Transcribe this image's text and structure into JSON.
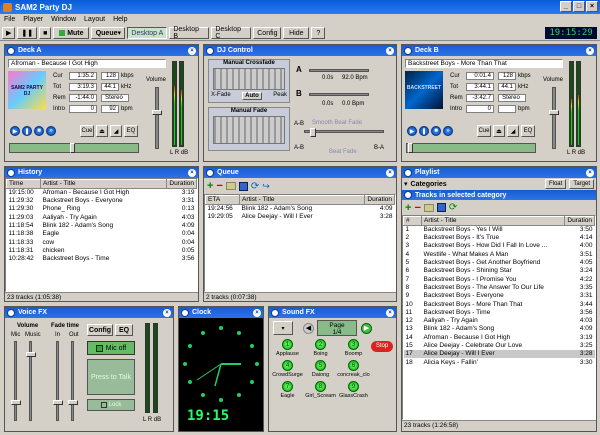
{
  "window": {
    "title": "SAM2 Party DJ"
  },
  "menu": [
    "File",
    "Player",
    "Window",
    "Layout",
    "Help"
  ],
  "toolbar": {
    "mute": "Mute",
    "queue": "Queue",
    "tabs": [
      "Desktop A",
      "Desktop B",
      "Desktop C"
    ],
    "config": "Config",
    "hide": "Hide",
    "help": "?",
    "clock": "19:15:29"
  },
  "deckA": {
    "title": "Deck A",
    "track": "Afroman - Because I Got High",
    "cur": "1:35.2",
    "tot": "3:19.3",
    "rem": "-1:44.0",
    "intro": "0",
    "kbps": "128",
    "khz": "44.1",
    "mode": "Stereo",
    "bpm": "92",
    "labels": {
      "cur": "Cur",
      "tot": "Tot",
      "rem": "Rem",
      "intro": "Intro",
      "kbps": "kbps",
      "khz": "kHz",
      "bpm": "bpm",
      "volume": "Volume",
      "cue": "Cue",
      "eq": "EQ",
      "lr": "L R dB"
    },
    "album_art_text": "SAM2 PARTY DJ",
    "vu_left": 0.7,
    "vu_right": 0.65,
    "volume_level": 0.6,
    "position": 0.48
  },
  "djControl": {
    "title": "DJ Control",
    "manual_crossfade": "Manual Crossfade",
    "xfade": "X-Fade",
    "auto": "Auto",
    "peak": "Peak",
    "manual_fade": "Manual Fade",
    "a": "A",
    "b": "B",
    "a_time": "0.0s",
    "a_bpm": "92.0 Bpm",
    "b_time": "0.0s",
    "b_bpm": "0.0 Bpm",
    "ab": "A-B",
    "ba": "B-A",
    "smooth_fade": "Smooth Beat Fade",
    "beat_fade": "Beat Fade"
  },
  "deckB": {
    "title": "Deck B",
    "track": "Backstreet Boys - More Than That",
    "cur": "0:01.4",
    "tot": "3:44.1",
    "rem": "-3:42.7",
    "intro": "0",
    "kbps": "128",
    "khz": "44.1",
    "mode": "Stereo",
    "bpm": "",
    "labels": {
      "cur": "Cur",
      "tot": "Tot",
      "rem": "Rem",
      "intro": "Intro",
      "kbps": "kbps",
      "khz": "kHz",
      "bpm": "bpm",
      "volume": "Volume",
      "cue": "Cue",
      "eq": "EQ",
      "lr": "L R dB"
    },
    "album_art_text": "BACKSTREET",
    "vu_left": 0.55,
    "vu_right": 0.6,
    "volume_level": 0.6,
    "position": 0.02
  },
  "history": {
    "title": "History",
    "columns": [
      "Time",
      "Artist - Title",
      "Duration"
    ],
    "rows": [
      [
        "19:15:00",
        "Afroman - Because I Got High",
        "3:19"
      ],
      [
        "11:29:32",
        "Backstreet Boys - Everyone",
        "3:31"
      ],
      [
        "11:29:30",
        "Phone_ Ring",
        "0:13"
      ],
      [
        "11:29:03",
        "Aaliyah - Try Again",
        "4:03"
      ],
      [
        "11:18:54",
        "Blink 182 - Adam's Song",
        "4:09"
      ],
      [
        "11:18:38",
        "Eagle",
        "0:04"
      ],
      [
        "11:18:33",
        "cow",
        "0:04"
      ],
      [
        "11:18:31",
        "chicken",
        "0:05"
      ],
      [
        "10:28:42",
        "Backstreet Boys - Time",
        "3:56"
      ]
    ],
    "status": "23 tracks (1:05:38)"
  },
  "queue": {
    "title": "Queue",
    "columns": [
      "ETA",
      "Artist - Title",
      "Duration"
    ],
    "rows": [
      [
        "19:24:56",
        "Blink 182 - Adam's Song",
        "4:09"
      ],
      [
        "19:29:05",
        "Alice Deejay - Will I Ever",
        "3:28"
      ]
    ],
    "status": "2 tracks (0:07:38)"
  },
  "playlist": {
    "title": "Playlist",
    "categories": "Categories",
    "float": "Float",
    "target": "Target",
    "subtitle": "Tracks in selected category",
    "columns": [
      "#",
      "Artist - Title",
      "Duration"
    ],
    "rows": [
      [
        "1",
        "Backstreet Boys - Yes I Will",
        "3:50"
      ],
      [
        "2",
        "Backstreet Boys - It's True",
        "4:14"
      ],
      [
        "3",
        "Backstreet Boys - How Did I Fall In Love ...",
        "4:00"
      ],
      [
        "4",
        "Westlife - What Makes A Man",
        "3:51"
      ],
      [
        "5",
        "Backstreet Boys - Get Another Boyfriend",
        "4:05"
      ],
      [
        "6",
        "Backstreet Boys - Shining Star",
        "3:24"
      ],
      [
        "7",
        "Backstreet Boys - I Promise You",
        "4:22"
      ],
      [
        "8",
        "Backstreet Boys - The Answer To Our Life",
        "3:35"
      ],
      [
        "9",
        "Backstreet Boys - Everyone",
        "3:31"
      ],
      [
        "10",
        "Backstreet Boys - More Than That",
        "3:44"
      ],
      [
        "11",
        "Backstreet Boys - Time",
        "3:56"
      ],
      [
        "12",
        "Aaliyah - Try Again",
        "4:03"
      ],
      [
        "13",
        "Blink 182 - Adam's Song",
        "4:09"
      ],
      [
        "14",
        "Afroman - Because I Got High",
        "3:19"
      ],
      [
        "15",
        "Alice Deejay - Celebrate Our Love",
        "3:25"
      ],
      [
        "17",
        "Alice Deejay - Will I Ever",
        "3:28"
      ],
      [
        "18",
        "Alicia Keys - Fallin'",
        "3:30"
      ]
    ],
    "highlight_index": 15,
    "status": "23 tracks (1:26:58)"
  },
  "voiceFx": {
    "title": "Voice FX",
    "volume": "Volume",
    "fade_time": "Fade time",
    "mic": "Mic",
    "music": "Music",
    "in": "In",
    "out": "Out",
    "config": "Config",
    "eq": "EQ",
    "mic_off": "Mic off",
    "press_to_talk": "Press to Talk",
    "lock": "Lock",
    "lr": "L R dB"
  },
  "clockPanel": {
    "title": "Clock",
    "digital": "19:15"
  },
  "soundFx": {
    "title": "Sound FX",
    "page_label": "Page",
    "page_value": "1/4",
    "stop": "Stop",
    "pads": [
      [
        "1",
        "Applause"
      ],
      [
        "2",
        "Boing"
      ],
      [
        "3",
        "Boomp"
      ],
      [
        "4",
        "CrowdSurge"
      ],
      [
        "5",
        "Daiong"
      ],
      [
        "6",
        "concreak_clo"
      ],
      [
        "7",
        "Eagle"
      ],
      [
        "8",
        "Girl_Scream"
      ],
      [
        "9",
        "GlassCrash"
      ]
    ]
  }
}
